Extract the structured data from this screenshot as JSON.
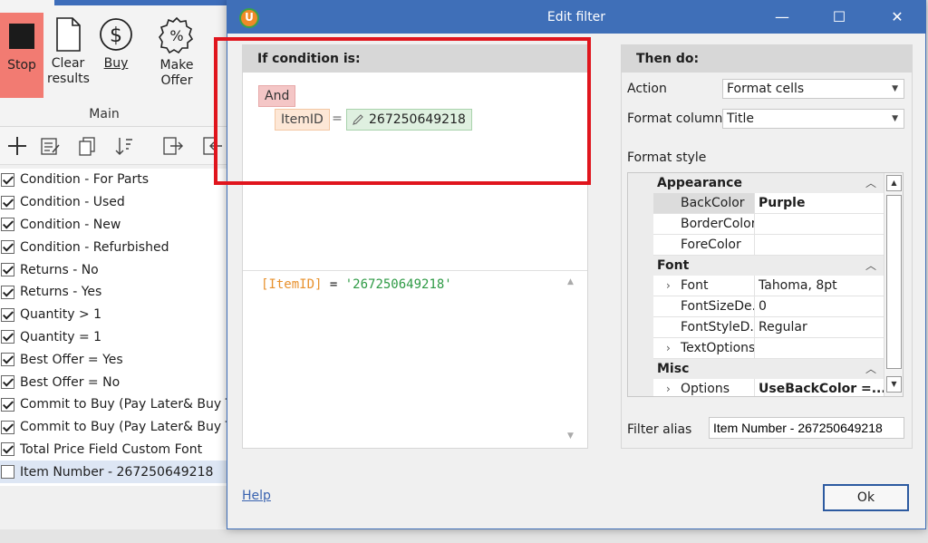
{
  "ribbon": {
    "stop_label": "Stop",
    "clear_label_1": "Clear",
    "clear_label_2": "results",
    "buy_label": "Buy",
    "offer_label": "Make Offer",
    "group_label": "Main"
  },
  "filters": [
    {
      "label": "Condition - For Parts",
      "checked": true
    },
    {
      "label": "Condition - Used",
      "checked": true
    },
    {
      "label": "Condition - New",
      "checked": true
    },
    {
      "label": "Condition - Refurbished",
      "checked": true
    },
    {
      "label": "Returns - No",
      "checked": true
    },
    {
      "label": "Returns - Yes",
      "checked": true
    },
    {
      "label": "Quantity > 1",
      "checked": true
    },
    {
      "label": "Quantity = 1",
      "checked": true
    },
    {
      "label": "Best Offer = Yes",
      "checked": true
    },
    {
      "label": "Best Offer = No",
      "checked": true
    },
    {
      "label": "Commit to Buy (Pay Later& Buy Thro",
      "checked": true
    },
    {
      "label": "Commit to Buy (Pay Later& Buy Thro",
      "checked": true
    },
    {
      "label": "Total Price Field Custom Font",
      "checked": true
    },
    {
      "label": "Item Number - 267250649218",
      "checked": false,
      "selected": true
    }
  ],
  "dialog": {
    "title": "Edit filter",
    "logo_letter": "U",
    "min_glyph": "—",
    "max_glyph": "☐",
    "close_glyph": "✕",
    "condition": {
      "header": "If condition is:",
      "group_op": "And",
      "field": "ItemID",
      "operator": "=",
      "value": "267250649218",
      "expr_field": "[ItemID]",
      "expr_op": " = ",
      "expr_value": "'267250649218'"
    },
    "then": {
      "header": "Then do:",
      "action_label": "Action",
      "action_value": "Format cells",
      "format_column_label": "Format column",
      "format_column_value": "Title",
      "format_style_label": "Format style",
      "grid": {
        "cat_appearance": "Appearance",
        "backcolor_name": "BackColor",
        "backcolor_value": "Purple",
        "bordercolor_name": "BorderColor",
        "bordercolor_value": "",
        "forecolor_name": "ForeColor",
        "forecolor_value": "",
        "cat_font": "Font",
        "font_name": "Font",
        "font_value": "Tahoma, 8pt",
        "fontsize_name": "FontSizeDe...",
        "fontsize_value": "0",
        "fontstyle_name": "FontStyleD...",
        "fontstyle_value": "Regular",
        "textoptions_name": "TextOptions",
        "textoptions_value": "",
        "cat_misc": "Misc",
        "options_name": "Options",
        "options_value": "UseBackColor =..."
      },
      "alias_label": "Filter alias",
      "alias_value": "Item Number - 267250649218"
    },
    "help_label": "Help",
    "ok_label": "Ok"
  },
  "colors": {
    "accent": "#3f6fb8",
    "stop": "#f27b72",
    "highlight": "#e0151d",
    "expr_field": "#e8912d",
    "expr_value": "#2e9a45"
  }
}
